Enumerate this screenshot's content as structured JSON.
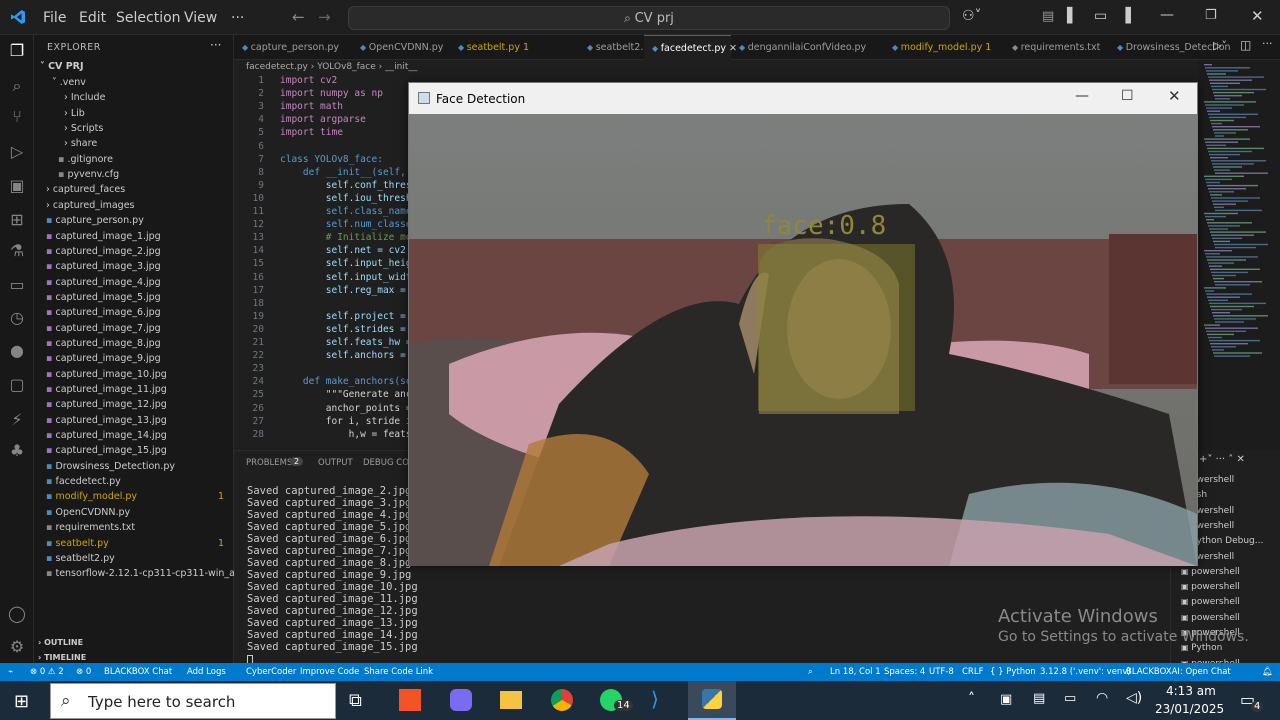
{
  "titlebar": {
    "menu": [
      "File",
      "Edit",
      "Selection",
      "View",
      "···"
    ],
    "search": "CV prj"
  },
  "sidebar": {
    "header": "EXPLORER",
    "project": "CV PRJ",
    "items": [
      ".venv",
      "Include",
      "Lib",
      "Scripts",
      "share",
      ".gitignore",
      "pyvenv.cfg",
      "captured_faces",
      "captured_images",
      "capture_person.py",
      "captured_image_1.jpg",
      "captured_image_2.jpg",
      "captured_image_3.jpg",
      "captured_image_4.jpg",
      "captured_image_5.jpg",
      "captured_image_6.jpg",
      "captured_image_7.jpg",
      "captured_image_8.jpg",
      "captured_image_9.jpg",
      "captured_image_10.jpg",
      "captured_image_11.jpg",
      "captured_image_12.jpg",
      "captured_image_13.jpg",
      "captured_image_14.jpg",
      "captured_image_15.jpg",
      "Drowsiness_Detection.py",
      "facedetect.py",
      "modify_model.py",
      "OpenCVDNN.py",
      "requirements.txt",
      "seatbelt.py",
      "seatbelt2.py",
      "tensorflow-2.12.1-cp311-cp311-win_amd6..."
    ],
    "badges": {
      "modify": "1",
      "seatbelt": "1"
    },
    "outline": "OUTLINE",
    "timeline": "TIMELINE"
  },
  "tabs": [
    "capture_person.py",
    "OpenCVDNN.py",
    "seatbelt.py 1",
    "seatbelt2.py",
    "facedetect.py",
    "dengannilaiConfVideo.py",
    "modify_model.py 1",
    "requirements.txt",
    "Drowsiness_Detection"
  ],
  "breadcrumb": [
    "facedetect.py",
    "YOLOv8_face",
    "__init__"
  ],
  "code": {
    "lines": [
      "1",
      "2",
      "3",
      "4",
      "5",
      "6",
      "7",
      "8",
      "9",
      "10",
      "11",
      "12",
      "13",
      "14",
      "15",
      "16",
      "17",
      "18",
      "19",
      "20",
      "21",
      "22",
      "23",
      "24",
      "25",
      "26",
      "27",
      "28"
    ],
    "text": [
      "import cv2",
      "import numpy as np",
      "import math",
      "import argparse",
      "import time",
      "",
      "class YOLOv8_face:",
      "    def __init__(self, p",
      "        self.conf_thresh",
      "        self.iou_thresho",
      "        self.class_names",
      "        self.num_classes",
      "        # Initialize mod",
      "        self.net = cv2.d",
      "        self.input_heigh",
      "        self.input_width",
      "        self.reg_max = 1",
      "",
      "        self.project = n",
      "        self.strides = (",
      "        self.feats_hw =",
      "        self.anchors = s",
      "",
      "    def make_anchors(sel",
      "        \"\"\"Generate anch",
      "        anchor_points =",
      "        for i, stride in",
      "            h,w = feats_"
    ]
  },
  "panel": {
    "tabs": [
      "PROBLEMS",
      "OUTPUT",
      "DEBUG CONS"
    ],
    "problems_count": "2",
    "terminal": [
      "Saved captured_image_2.jpg",
      "Saved captured_image_3.jpg",
      "Saved captured_image_4.jpg",
      "Saved captured_image_5.jpg",
      "Saved captured_image_6.jpg",
      "Saved captured_image_7.jpg",
      "Saved captured_image_8.jpg",
      "Saved captured_image_9.jpg",
      "Saved captured_image_10.jpg",
      "Saved captured_image_11.jpg",
      "Saved captured_image_12.jpg",
      "Saved captured_image_13.jpg",
      "Saved captured_image_14.jpg",
      "Saved captured_image_15.jpg"
    ],
    "terminals": [
      "owershell",
      "ash",
      "owershell",
      "owershell",
      "Python Debug...",
      "owershell",
      "powershell",
      "powershell",
      "powershell",
      "powershell",
      "powershell",
      "Python",
      "powershell"
    ]
  },
  "face_window": {
    "title": "Face Detection",
    "label": "face:0.8"
  },
  "watermark": {
    "title": "Activate Windows",
    "subtitle": "Go to Settings to activate Windows."
  },
  "statusbar": {
    "left": [
      "⊗ 0 ⚠ 2",
      "⊗ 0",
      "BLACKBOX Chat",
      "Add Logs",
      "CyberCoder",
      "Improve Code",
      "Share Code Link"
    ],
    "right": [
      "Ln 18, Col 1",
      "Spaces: 4",
      "UTF-8",
      "CRLF",
      "{ } Python",
      "3.12.8 ('.venv': venv)",
      "BLACKBOXAI: Open Chat"
    ]
  },
  "taskbar": {
    "search": "Type here to search",
    "time": "4:13 am",
    "date": "23/01/2025",
    "whatsapp_badge": "14",
    "notif_badge": "4"
  }
}
